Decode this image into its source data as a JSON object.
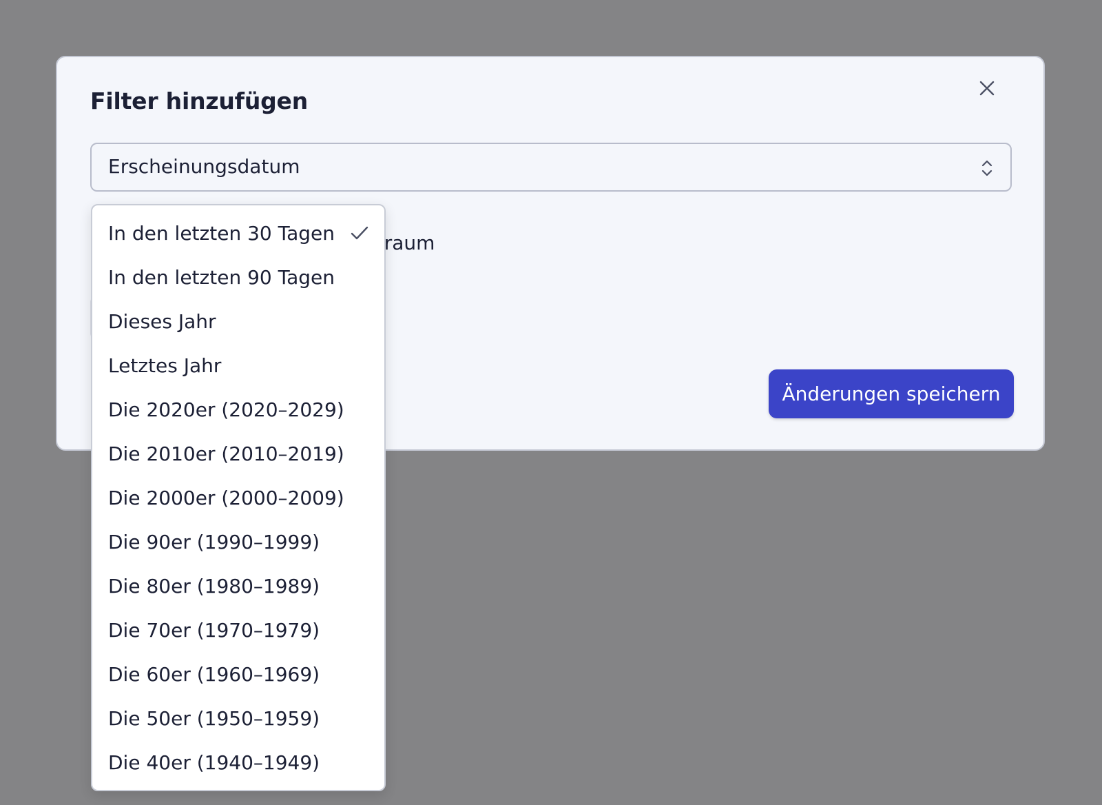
{
  "modal": {
    "title": "Filter hinzufügen",
    "close_icon": "close-icon",
    "field_select": {
      "value": "Erscheinungsdatum",
      "icon": "chevron-up-down-icon"
    },
    "obscured_label_fragment": "itraum",
    "save_button": "Änderungen speichern"
  },
  "dropdown": {
    "selected_index": 0,
    "check_icon": "check-icon",
    "options": [
      "In den letzten 30 Tagen",
      "In den letzten 90 Tagen",
      "Dieses Jahr",
      "Letztes Jahr",
      "Die 2020er (2020–2029)",
      "Die 2010er (2010–2019)",
      "Die 2000er (2000–2009)",
      "Die 90er (1990–1999)",
      "Die 80er (1980–1989)",
      "Die 70er (1970–1979)",
      "Die 60er (1960–1969)",
      "Die 50er (1950–1959)",
      "Die 40er (1940–1949)"
    ]
  },
  "colors": {
    "backdrop": "#848486",
    "modal_background": "#f4f6fb",
    "primary_button": "#3b44c8",
    "text": "#1c2035"
  }
}
